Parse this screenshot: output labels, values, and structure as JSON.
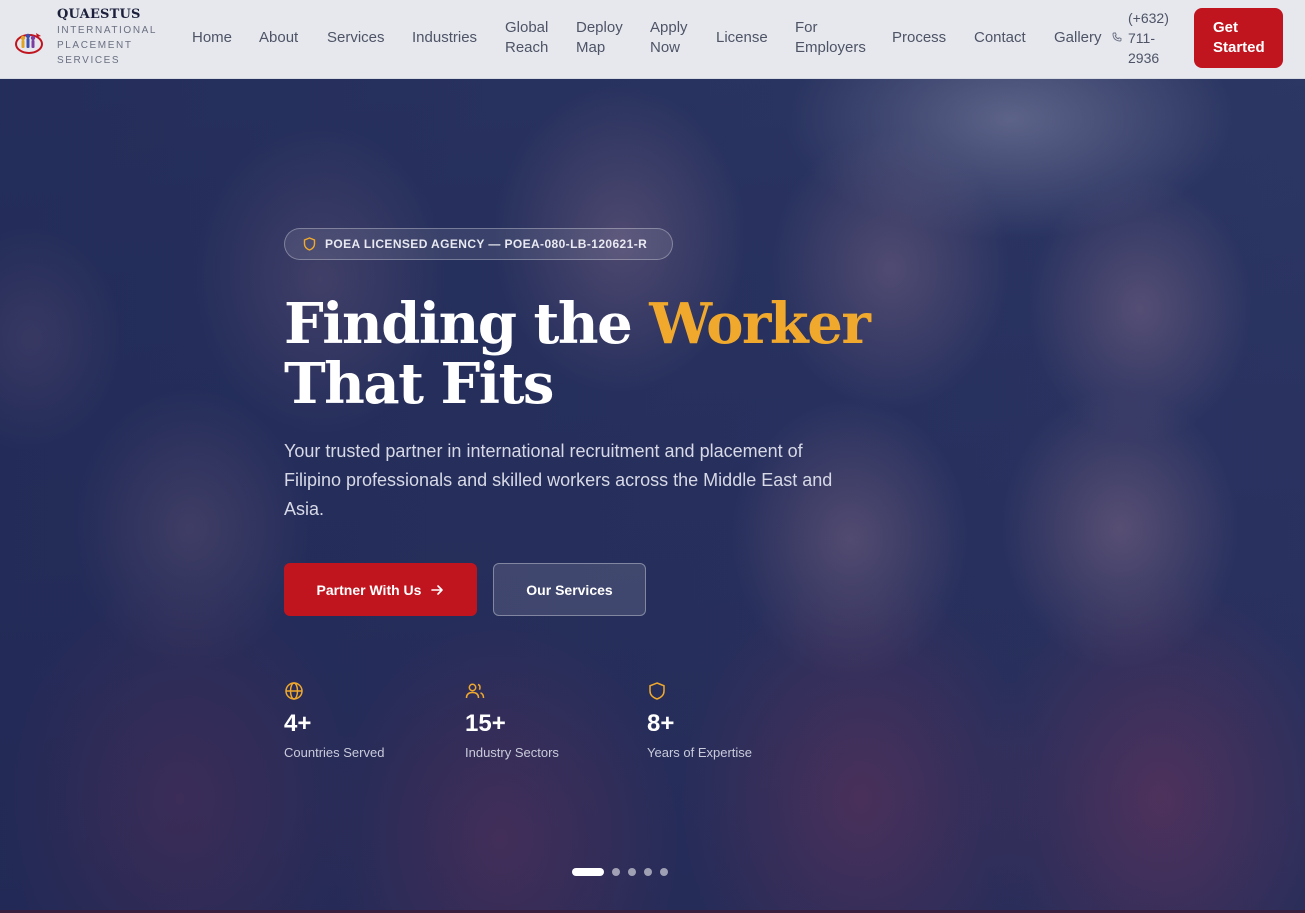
{
  "brand": {
    "name": "QUAESTUS",
    "subtitle": "INTERNATIONAL PLACEMENT SERVICES"
  },
  "nav": {
    "items": [
      {
        "label": "Home"
      },
      {
        "label": "About"
      },
      {
        "label": "Services"
      },
      {
        "label": "Industries"
      },
      {
        "label": "Global Reach"
      },
      {
        "label": "Deploy Map"
      },
      {
        "label": "Apply Now"
      },
      {
        "label": "License"
      },
      {
        "label": "For Employers"
      },
      {
        "label": "Process"
      },
      {
        "label": "Contact"
      },
      {
        "label": "Gallery"
      }
    ],
    "phone": "(+632) 711-2936",
    "cta": "Get Started"
  },
  "hero": {
    "badge": "POEA LICENSED AGENCY — POEA-080-LB-120621-R",
    "headline_part1": "Finding the ",
    "headline_accent": "Worker",
    "headline_part2": "That Fits",
    "lead": "Your trusted partner in international recruitment and placement of Filipino professionals and skilled workers across the Middle East and Asia.",
    "primary_button": "Partner With Us",
    "secondary_button": "Our Services",
    "stats": [
      {
        "value": "4+",
        "label": "Countries Served",
        "icon": "globe-icon"
      },
      {
        "value": "15+",
        "label": "Industry Sectors",
        "icon": "users-icon"
      },
      {
        "value": "8+",
        "label": "Years of Expertise",
        "icon": "shield-icon"
      }
    ],
    "slides_total": 5,
    "active_slide": 1
  },
  "colors": {
    "primary_red": "#c0151f",
    "accent_gold": "#f0a92c",
    "hero_navy": "#2c3563"
  }
}
